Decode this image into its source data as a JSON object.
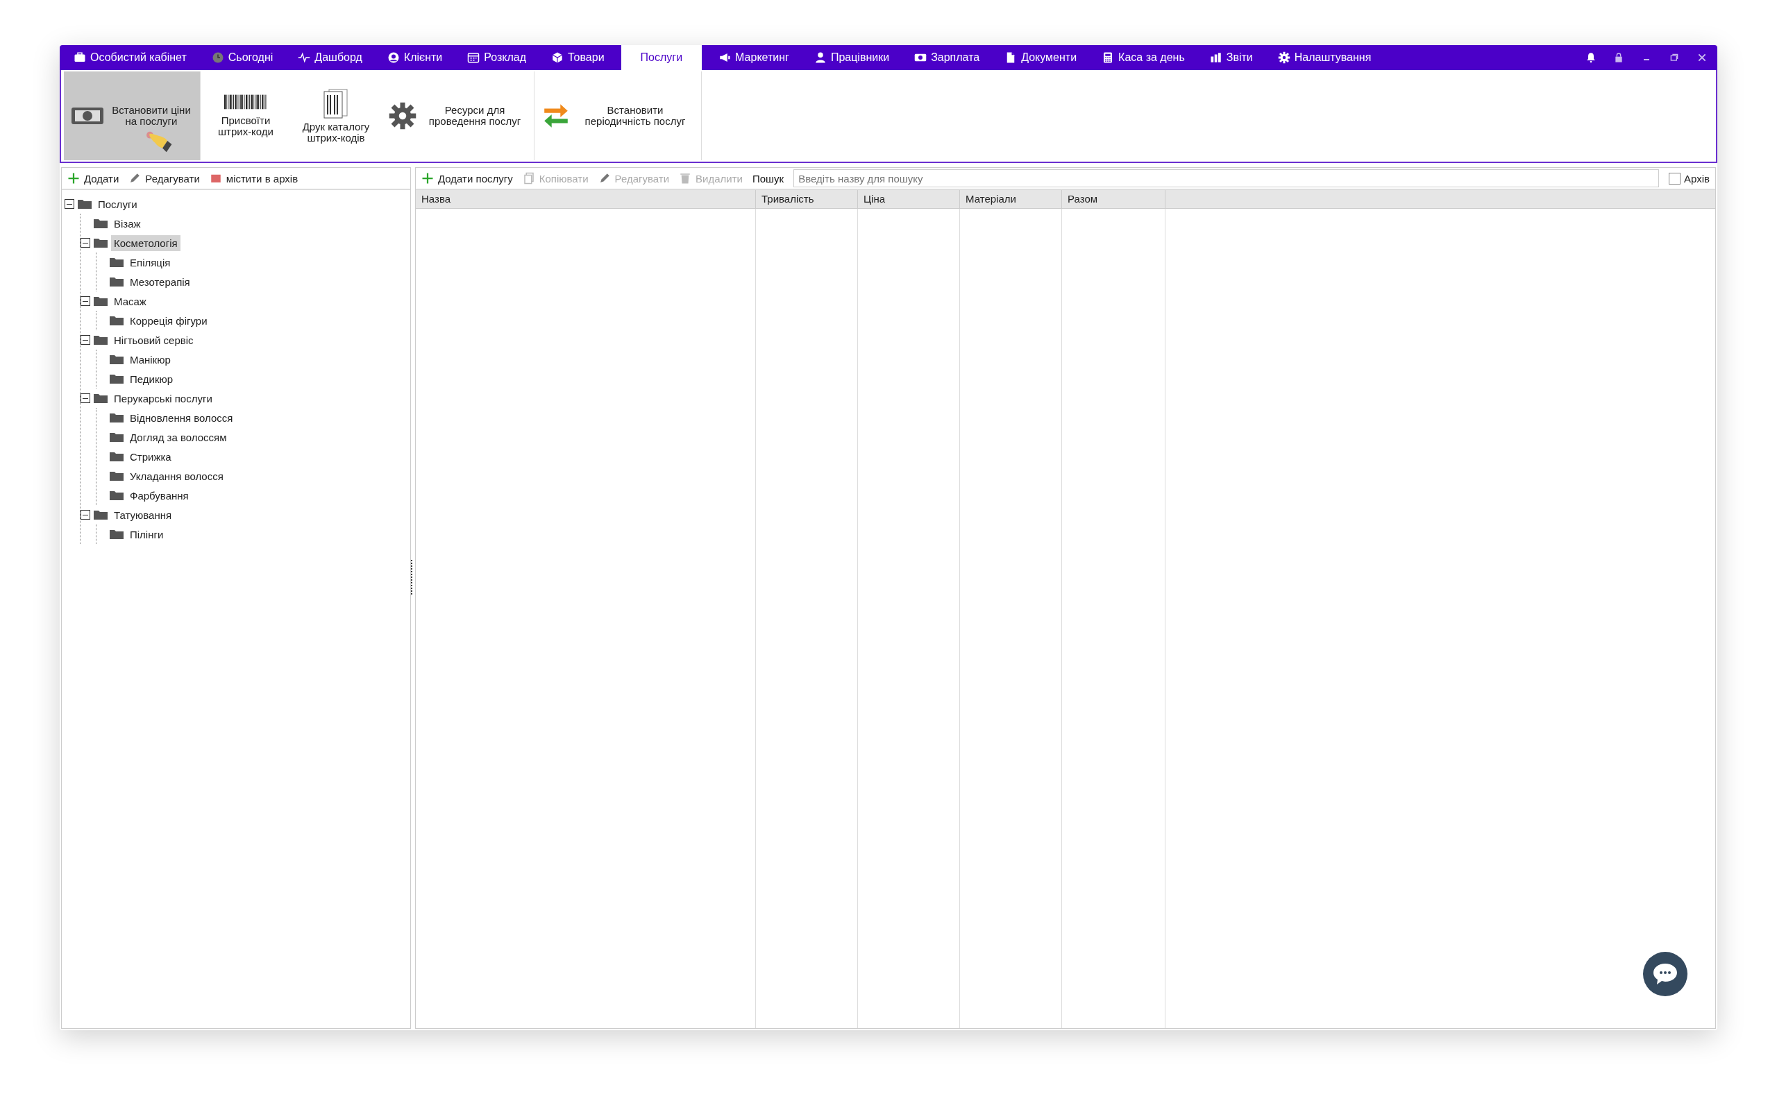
{
  "nav_tabs": [
    {
      "label": "Особистий кабінет",
      "selected": false
    },
    {
      "label": "Сьогодні",
      "selected": false
    },
    {
      "label": "Дашборд",
      "selected": false
    },
    {
      "label": "Клієнти",
      "selected": false
    },
    {
      "label": "Розклад",
      "selected": false
    },
    {
      "label": "Товари",
      "selected": false
    },
    {
      "label": "Послуги",
      "selected": true
    },
    {
      "label": "Маркетинг",
      "selected": false
    },
    {
      "label": "Працівники",
      "selected": false
    },
    {
      "label": "Зарплата",
      "selected": false
    },
    {
      "label": "Документи",
      "selected": false
    },
    {
      "label": "Каса за день",
      "selected": false
    },
    {
      "label": "Звіти",
      "selected": false
    },
    {
      "label": "Налаштування",
      "selected": false
    }
  ],
  "ribbon": [
    {
      "label": "Встановити ціни на послуги",
      "selected": true
    },
    {
      "label": "Присвоїти штрих-коди",
      "selected": false
    },
    {
      "label": "Друк каталогу штрих-кодів",
      "selected": false
    },
    {
      "label": "Ресурси для проведення послуг",
      "selected": false
    },
    {
      "label": "Встановити періодичність послуг",
      "selected": false
    }
  ],
  "tree_toolbar": [
    {
      "label": "Додати",
      "disabled": false
    },
    {
      "label": "Редагувати",
      "disabled": false
    },
    {
      "label": "містити в архів",
      "disabled": false
    }
  ],
  "tree": [
    {
      "label": "Послуги",
      "expanded": true,
      "selected": false,
      "children": [
        {
          "label": "Візаж",
          "selected": false
        },
        {
          "label": "Косметологія",
          "expanded": true,
          "selected": true,
          "children": [
            {
              "label": "Епіляція",
              "selected": false
            },
            {
              "label": "Мезотерапія",
              "selected": false
            }
          ]
        },
        {
          "label": "Масаж",
          "expanded": true,
          "selected": false,
          "children": [
            {
              "label": "Корреція фігури",
              "selected": false
            }
          ]
        },
        {
          "label": "Нігтьовий сервіс",
          "expanded": true,
          "selected": false,
          "children": [
            {
              "label": "Манікюр",
              "selected": false
            },
            {
              "label": "Педикюр",
              "selected": false
            }
          ]
        },
        {
          "label": "Перукарські послуги",
          "expanded": true,
          "selected": false,
          "children": [
            {
              "label": "Відновлення волосся",
              "selected": false
            },
            {
              "label": "Догляд за волоссям",
              "selected": false
            },
            {
              "label": "Стрижка",
              "selected": false
            },
            {
              "label": "Укладання волосся",
              "selected": false
            },
            {
              "label": "Фарбування",
              "selected": false
            }
          ]
        },
        {
          "label": "Татуювання",
          "expanded": true,
          "selected": false,
          "children": [
            {
              "label": "Пілінги",
              "selected": false
            }
          ]
        }
      ]
    }
  ],
  "services_toolbar": [
    {
      "label": "Додати послугу",
      "disabled": false
    },
    {
      "label": "Копіювати",
      "disabled": true
    },
    {
      "label": "Редагувати",
      "disabled": true
    },
    {
      "label": "Видалити",
      "disabled": true
    }
  ],
  "search": {
    "label": "Пошук",
    "placeholder": "Введіть назву для пошуку"
  },
  "archive_checkbox": {
    "label": "Архів",
    "checked": false
  },
  "table": {
    "columns": [
      "Назва",
      "Тривалість",
      "Ціна",
      "Матеріали",
      "Разом"
    ]
  }
}
